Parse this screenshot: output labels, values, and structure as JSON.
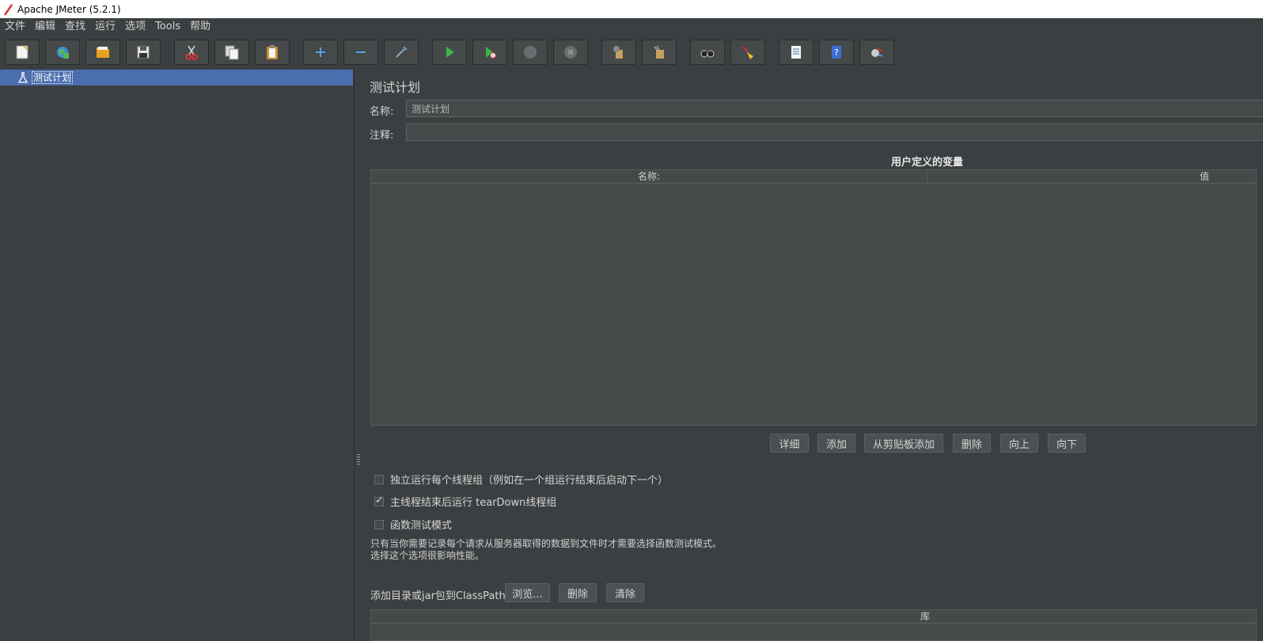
{
  "window": {
    "title": "Apache JMeter (5.2.1)"
  },
  "menu": [
    "文件",
    "编辑",
    "查找",
    "运行",
    "选项",
    "Tools",
    "帮助"
  ],
  "toolbar": {
    "icons": [
      "new-icon",
      "templates-icon",
      "open-icon",
      "save-icon",
      "cut-icon",
      "copy-icon",
      "paste-icon",
      "expand-icon",
      "collapse-icon",
      "toggle-icon",
      "start-icon",
      "start-no-pause-icon",
      "stop-icon",
      "shutdown-icon",
      "clear-icon",
      "clear-all-icon",
      "search-icon",
      "reset-search-icon",
      "function-helper-icon",
      "help-icon",
      "remote-icon"
    ]
  },
  "tree": {
    "root_label": "测试计划"
  },
  "panel": {
    "title": "测试计划",
    "name_label": "名称:",
    "name_value": "测试计划",
    "comment_label": "注释:",
    "comment_value": ""
  },
  "variables": {
    "caption": "用户定义的变量",
    "columns": [
      "名称:",
      "值"
    ],
    "rows": []
  },
  "buttons": {
    "detail": "详细",
    "add": "添加",
    "add_clipboard": "从剪贴板添加",
    "delete": "删除",
    "up": "向上",
    "down": "向下"
  },
  "options": [
    {
      "label": "独立运行每个线程组（例如在一个组运行结束后启动下一个）",
      "checked": false
    },
    {
      "label": "主线程结束后运行 tearDown线程组",
      "checked": true
    },
    {
      "label": "函数测试模式",
      "checked": false
    }
  ],
  "functional_note": [
    "只有当你需要记录每个请求从服务器取得的数据到文件时才需要选择函数测试模式。",
    "选择这个选项很影响性能。"
  ],
  "classpath": {
    "label": "添加目录或jar包到ClassPath",
    "browse": "浏览...",
    "delete": "删除",
    "clear": "清除",
    "column": "库"
  },
  "colors": {
    "background": "#3c3f41",
    "selection": "#4b6eaf",
    "field": "#45494a"
  }
}
